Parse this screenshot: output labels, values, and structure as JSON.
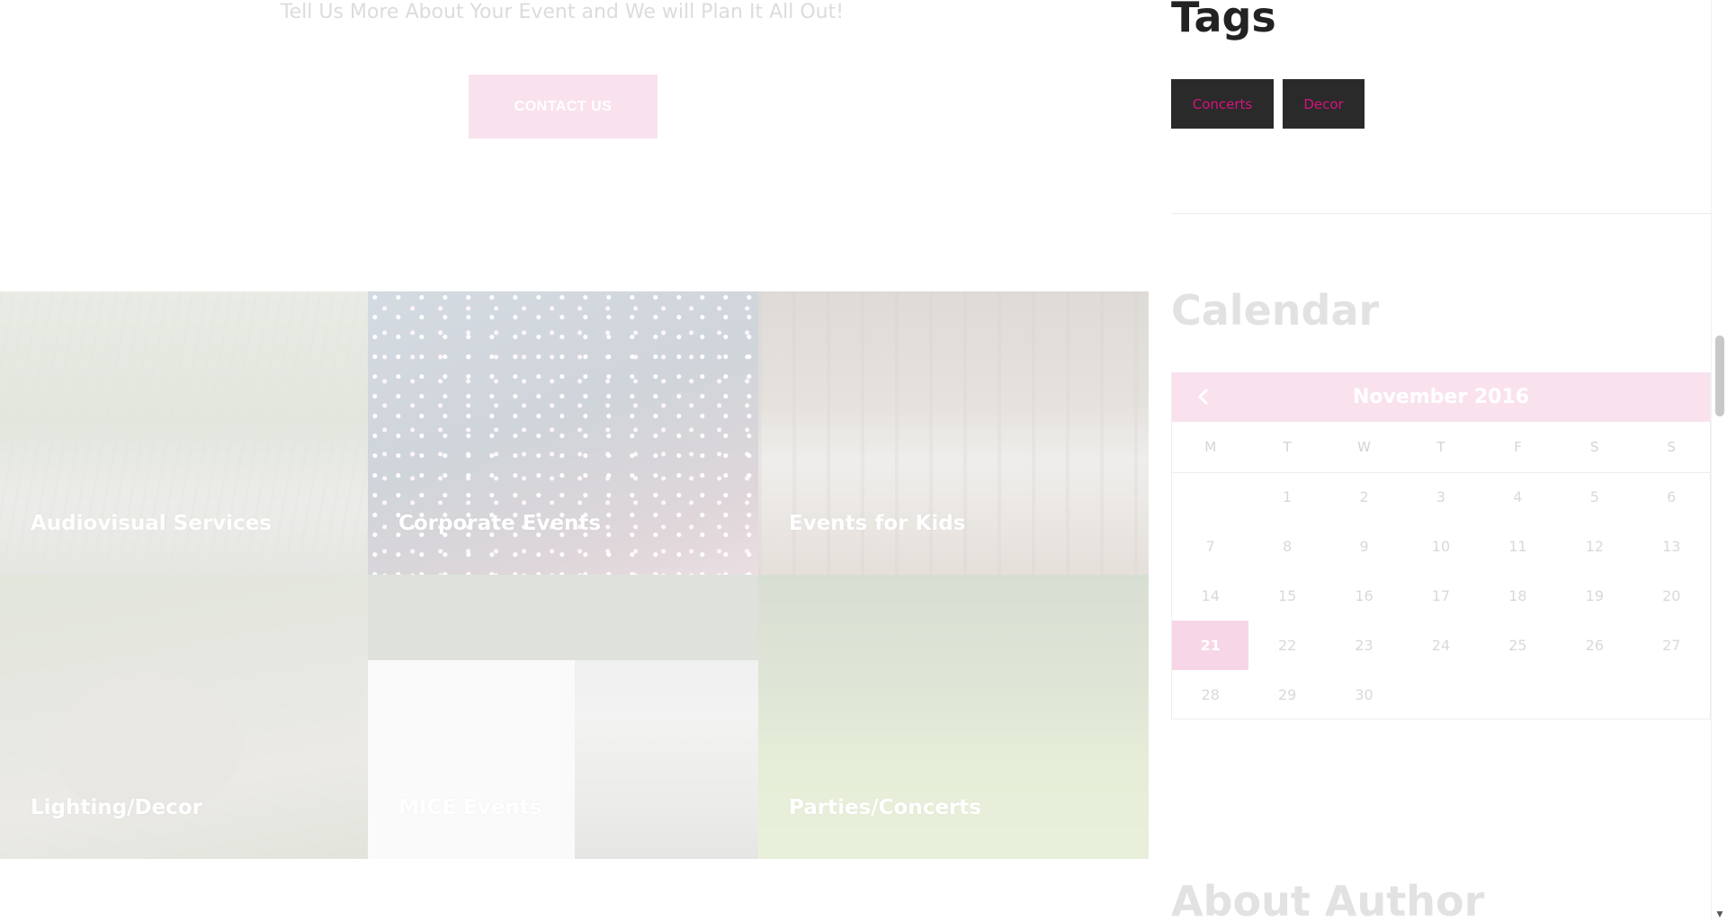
{
  "hero": {
    "tagline": "Tell Us More About Your Event and We will Plan It All Out!",
    "contact_button": "CONTACT US"
  },
  "services": [
    {
      "label": "Audiovisual Services"
    },
    {
      "label": "Corporate Events"
    },
    {
      "label": "Events for Kids"
    },
    {
      "label": "Lighting/Decor"
    },
    {
      "label": "MICE Events"
    },
    {
      "label": "Parties/Concerts"
    }
  ],
  "sidebar": {
    "tags_title": "Tags",
    "tags": [
      "Concerts",
      "Decor"
    ],
    "calendar_title": "Calendar",
    "calendar": {
      "month": "November 2016",
      "prev_icon": "chevron-left-icon",
      "weekdays": [
        "M",
        "T",
        "W",
        "T",
        "F",
        "S",
        "S"
      ],
      "weeks": [
        [
          "",
          "1",
          "2",
          "3",
          "4",
          "5",
          "6"
        ],
        [
          "7",
          "8",
          "9",
          "10",
          "11",
          "12",
          "13"
        ],
        [
          "14",
          "15",
          "16",
          "17",
          "18",
          "19",
          "20"
        ],
        [
          "21",
          "22",
          "23",
          "24",
          "25",
          "26",
          "27"
        ],
        [
          "28",
          "29",
          "30",
          "",
          "",
          "",
          ""
        ]
      ],
      "today": "21"
    },
    "about_title": "About Author"
  },
  "colors": {
    "accent": "#d6137c",
    "accent_light": "#f9e2ee",
    "tag_bg": "#2a2a2a"
  }
}
